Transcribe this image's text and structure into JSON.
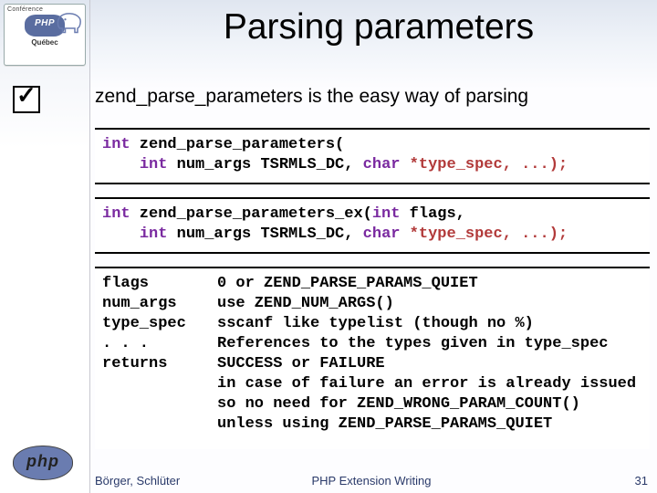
{
  "logo_top": {
    "line1": "Conférence",
    "line2": "Québec"
  },
  "title": "Parsing parameters",
  "bullet": "zend_parse_parameters is the easy way of parsing",
  "code1": {
    "l1_a": "int",
    "l1_b": " zend_parse_parameters(",
    "l2_a": "int",
    "l2_b": " num_args TSRMLS_DC, ",
    "l2_c": "char",
    "l2_d": " *type_spec, ...);"
  },
  "code2": {
    "l1_a": "int",
    "l1_b": " zend_parse_parameters_ex(",
    "l1_c": "int",
    "l1_d": " flags,",
    "l2_a": "int",
    "l2_b": " num_args TSRMLS_DC, ",
    "l2_c": "char",
    "l2_d": " *type_spec, ...);"
  },
  "params": {
    "k0": "flags",
    "v0": "0 or ZEND_PARSE_PARAMS_QUIET",
    "k1": "num_args",
    "v1": "use ZEND_NUM_ARGS()",
    "k2": "type_spec",
    "v2": "sscanf like typelist (though no %)",
    "k3": ". . .",
    "v3": "References to the types given in type_spec",
    "k4": "returns",
    "v4": "SUCCESS or FAILURE",
    "k5": "",
    "v5": "in case of failure an error is already issued",
    "k6": "",
    "v6": "so no need for ZEND_WRONG_PARAM_COUNT()",
    "k7": "",
    "v7": "unless using ZEND_PARSE_PARAMS_QUIET"
  },
  "footer": {
    "left": "Börger, Schlüter",
    "center": "PHP Extension Writing",
    "right": "31"
  }
}
